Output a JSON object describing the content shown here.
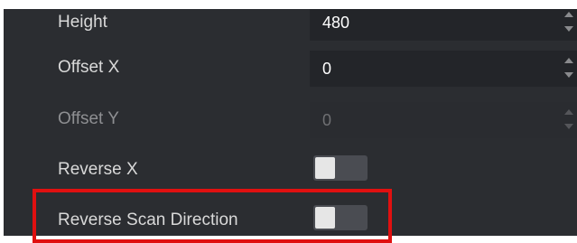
{
  "rows": [
    {
      "label": "Height",
      "value": "480",
      "enabled": true
    },
    {
      "label": "Offset X",
      "value": "0",
      "enabled": true
    },
    {
      "label": "Offset Y",
      "value": "0",
      "enabled": false
    },
    {
      "label": "Reverse X",
      "toggle": false
    },
    {
      "label": "Reverse Scan Direction",
      "toggle": false
    }
  ],
  "colors": {
    "panel_bg": "#2b2d31",
    "field_bg": "#232529",
    "highlight": "#e01010",
    "toggle_track": "#4a4c52",
    "toggle_knob": "#e6e6e6"
  },
  "icons": {
    "spin_up": "triangle-up-icon",
    "spin_down": "triangle-down-icon"
  }
}
